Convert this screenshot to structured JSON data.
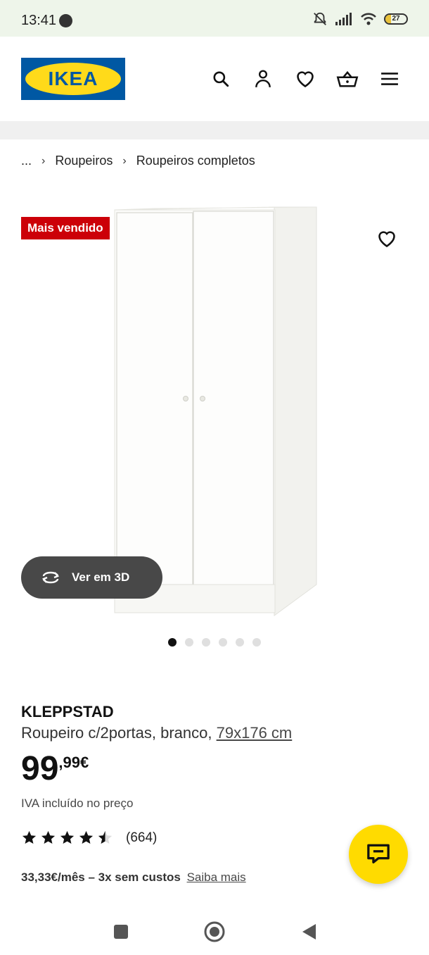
{
  "status_bar": {
    "time": "13:41",
    "battery": "27"
  },
  "header": {
    "logo_text": "IKEA",
    "icons": [
      "search-icon",
      "user-icon",
      "heart-icon",
      "basket-icon",
      "menu-icon"
    ]
  },
  "breadcrumb": {
    "ellipsis": "...",
    "items": [
      "Roupeiros",
      "Roupeiros completos"
    ]
  },
  "product": {
    "badge": "Mais vendido",
    "view_3d_label": "Ver em 3D",
    "image_dots_total": 6,
    "image_dots_active": 1,
    "name": "KLEPPSTAD",
    "description": "Roupeiro c/2portas, branco,",
    "dimensions": "79x176 cm",
    "price_integer": "99",
    "price_decimal": ",99€",
    "vat_note": "IVA incluído no preço",
    "rating_value": 4.5,
    "rating_count": "(664)",
    "installments_text": "33,33€/mês – 3x sem custos",
    "installments_link": "Saiba mais"
  },
  "colors": {
    "ikea_blue": "#0058a3",
    "ikea_yellow": "#ffda1a",
    "badge_red": "#cc0008",
    "chat_yellow": "#ffdb00"
  }
}
